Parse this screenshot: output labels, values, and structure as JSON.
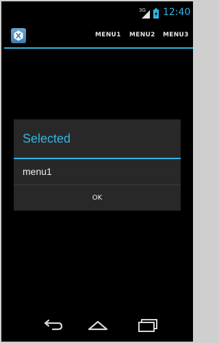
{
  "status_bar": {
    "network_label": "3G",
    "time": "12:40"
  },
  "action_bar": {
    "app_icon": "xamarin-x-icon",
    "menu": [
      "MENU1",
      "MENU2",
      "MENU3"
    ]
  },
  "dialog": {
    "title": "Selected",
    "message": "menu1",
    "ok_label": "OK"
  },
  "navigation_bar": {
    "icons": [
      "back-icon",
      "home-icon",
      "recent-apps-icon"
    ]
  },
  "colors": {
    "accent": "#33b5e5",
    "background": "#000000",
    "dialog_background": "#282828",
    "text": "#f0f0f0"
  }
}
